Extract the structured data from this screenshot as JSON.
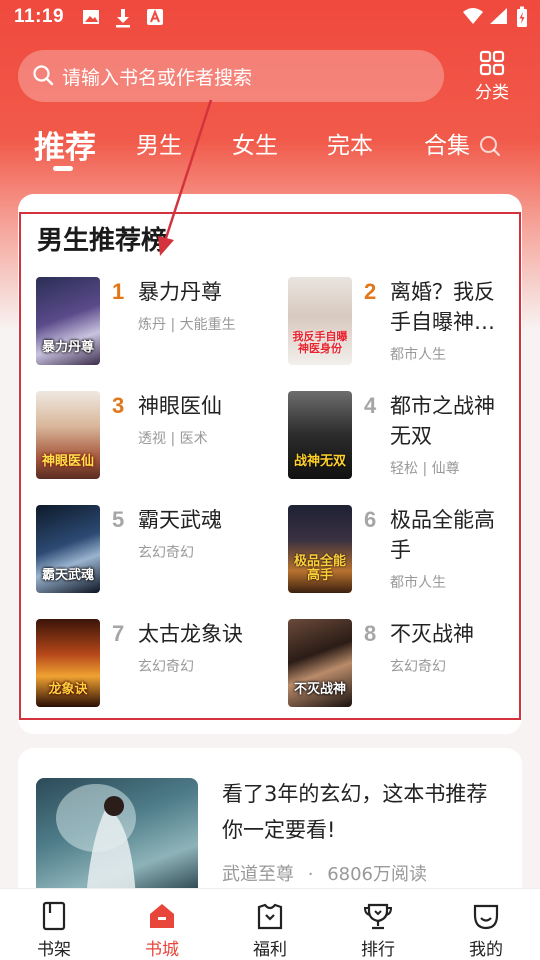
{
  "status_bar": {
    "time": "11:19"
  },
  "search": {
    "placeholder": "请输入书名或作者搜索"
  },
  "category": {
    "label": "分类"
  },
  "tabs": [
    {
      "label": "推荐",
      "active": true
    },
    {
      "label": "男生"
    },
    {
      "label": "女生"
    },
    {
      "label": "完本"
    },
    {
      "label": "合集"
    }
  ],
  "ranking": {
    "title": "男生推荐榜",
    "books": [
      {
        "rank": "1",
        "title": "暴力丹尊",
        "tags": "炼丹 | 大能重生",
        "cover_text": "暴力丹尊"
      },
      {
        "rank": "2",
        "title": "离婚？我反手自曝神…",
        "tags": "都市人生",
        "cover_text": "我反手自曝神医身份"
      },
      {
        "rank": "3",
        "title": "神眼医仙",
        "tags": "透视 | 医术",
        "cover_text": "神眼医仙"
      },
      {
        "rank": "4",
        "title": "都市之战神无双",
        "tags": "轻松 | 仙尊",
        "cover_text": "战神无双"
      },
      {
        "rank": "5",
        "title": "霸天武魂",
        "tags": "玄幻奇幻",
        "cover_text": "霸天武魂"
      },
      {
        "rank": "6",
        "title": "极品全能高手",
        "tags": "都市人生",
        "cover_text": "极品全能高手"
      },
      {
        "rank": "7",
        "title": "太古龙象诀",
        "tags": "玄幻奇幻",
        "cover_text": "龙象诀"
      },
      {
        "rank": "8",
        "title": "不灭战神",
        "tags": "玄幻奇幻",
        "cover_text": "不灭战神"
      }
    ]
  },
  "recommend": {
    "title": "看了3年的玄幻，这本书推荐你一定要看!",
    "book": "武道至尊",
    "dot": "·",
    "reads": "6806万阅读"
  },
  "bottom_nav": [
    {
      "label": "书架"
    },
    {
      "label": "书城",
      "active": true
    },
    {
      "label": "福利"
    },
    {
      "label": "排行"
    },
    {
      "label": "我的"
    }
  ],
  "colors": {
    "accent": "#e8463a",
    "rank_top": "#e2761a",
    "annotation": "#d4333d"
  }
}
